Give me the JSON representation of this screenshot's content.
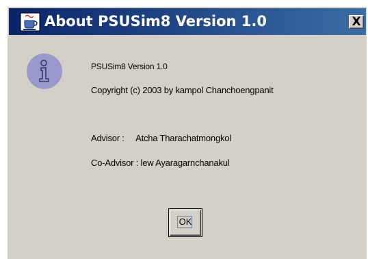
{
  "window": {
    "title": "About PSUSim8 Version 1.0",
    "close_label": "X",
    "title_icon": "java-coffee-cup-icon"
  },
  "content": {
    "icon": "info-icon",
    "product_line": "PSUSim8 Version 1.0",
    "copyright_line": "Copyright (c) 2003 by  kampol Chanchoengpanit",
    "advisor_line": "Advisor :     Atcha Tharachatmongkol",
    "coadvisor_line": "Co-Advisor : lew Ayaragarnchanakul"
  },
  "buttons": {
    "ok_label": "OK"
  },
  "colors": {
    "titlebar_start": "#0a246a",
    "titlebar_end": "#3a6ea5",
    "dialog_bg": "#d4d0c8",
    "info_icon_fill": "#9999cc"
  }
}
